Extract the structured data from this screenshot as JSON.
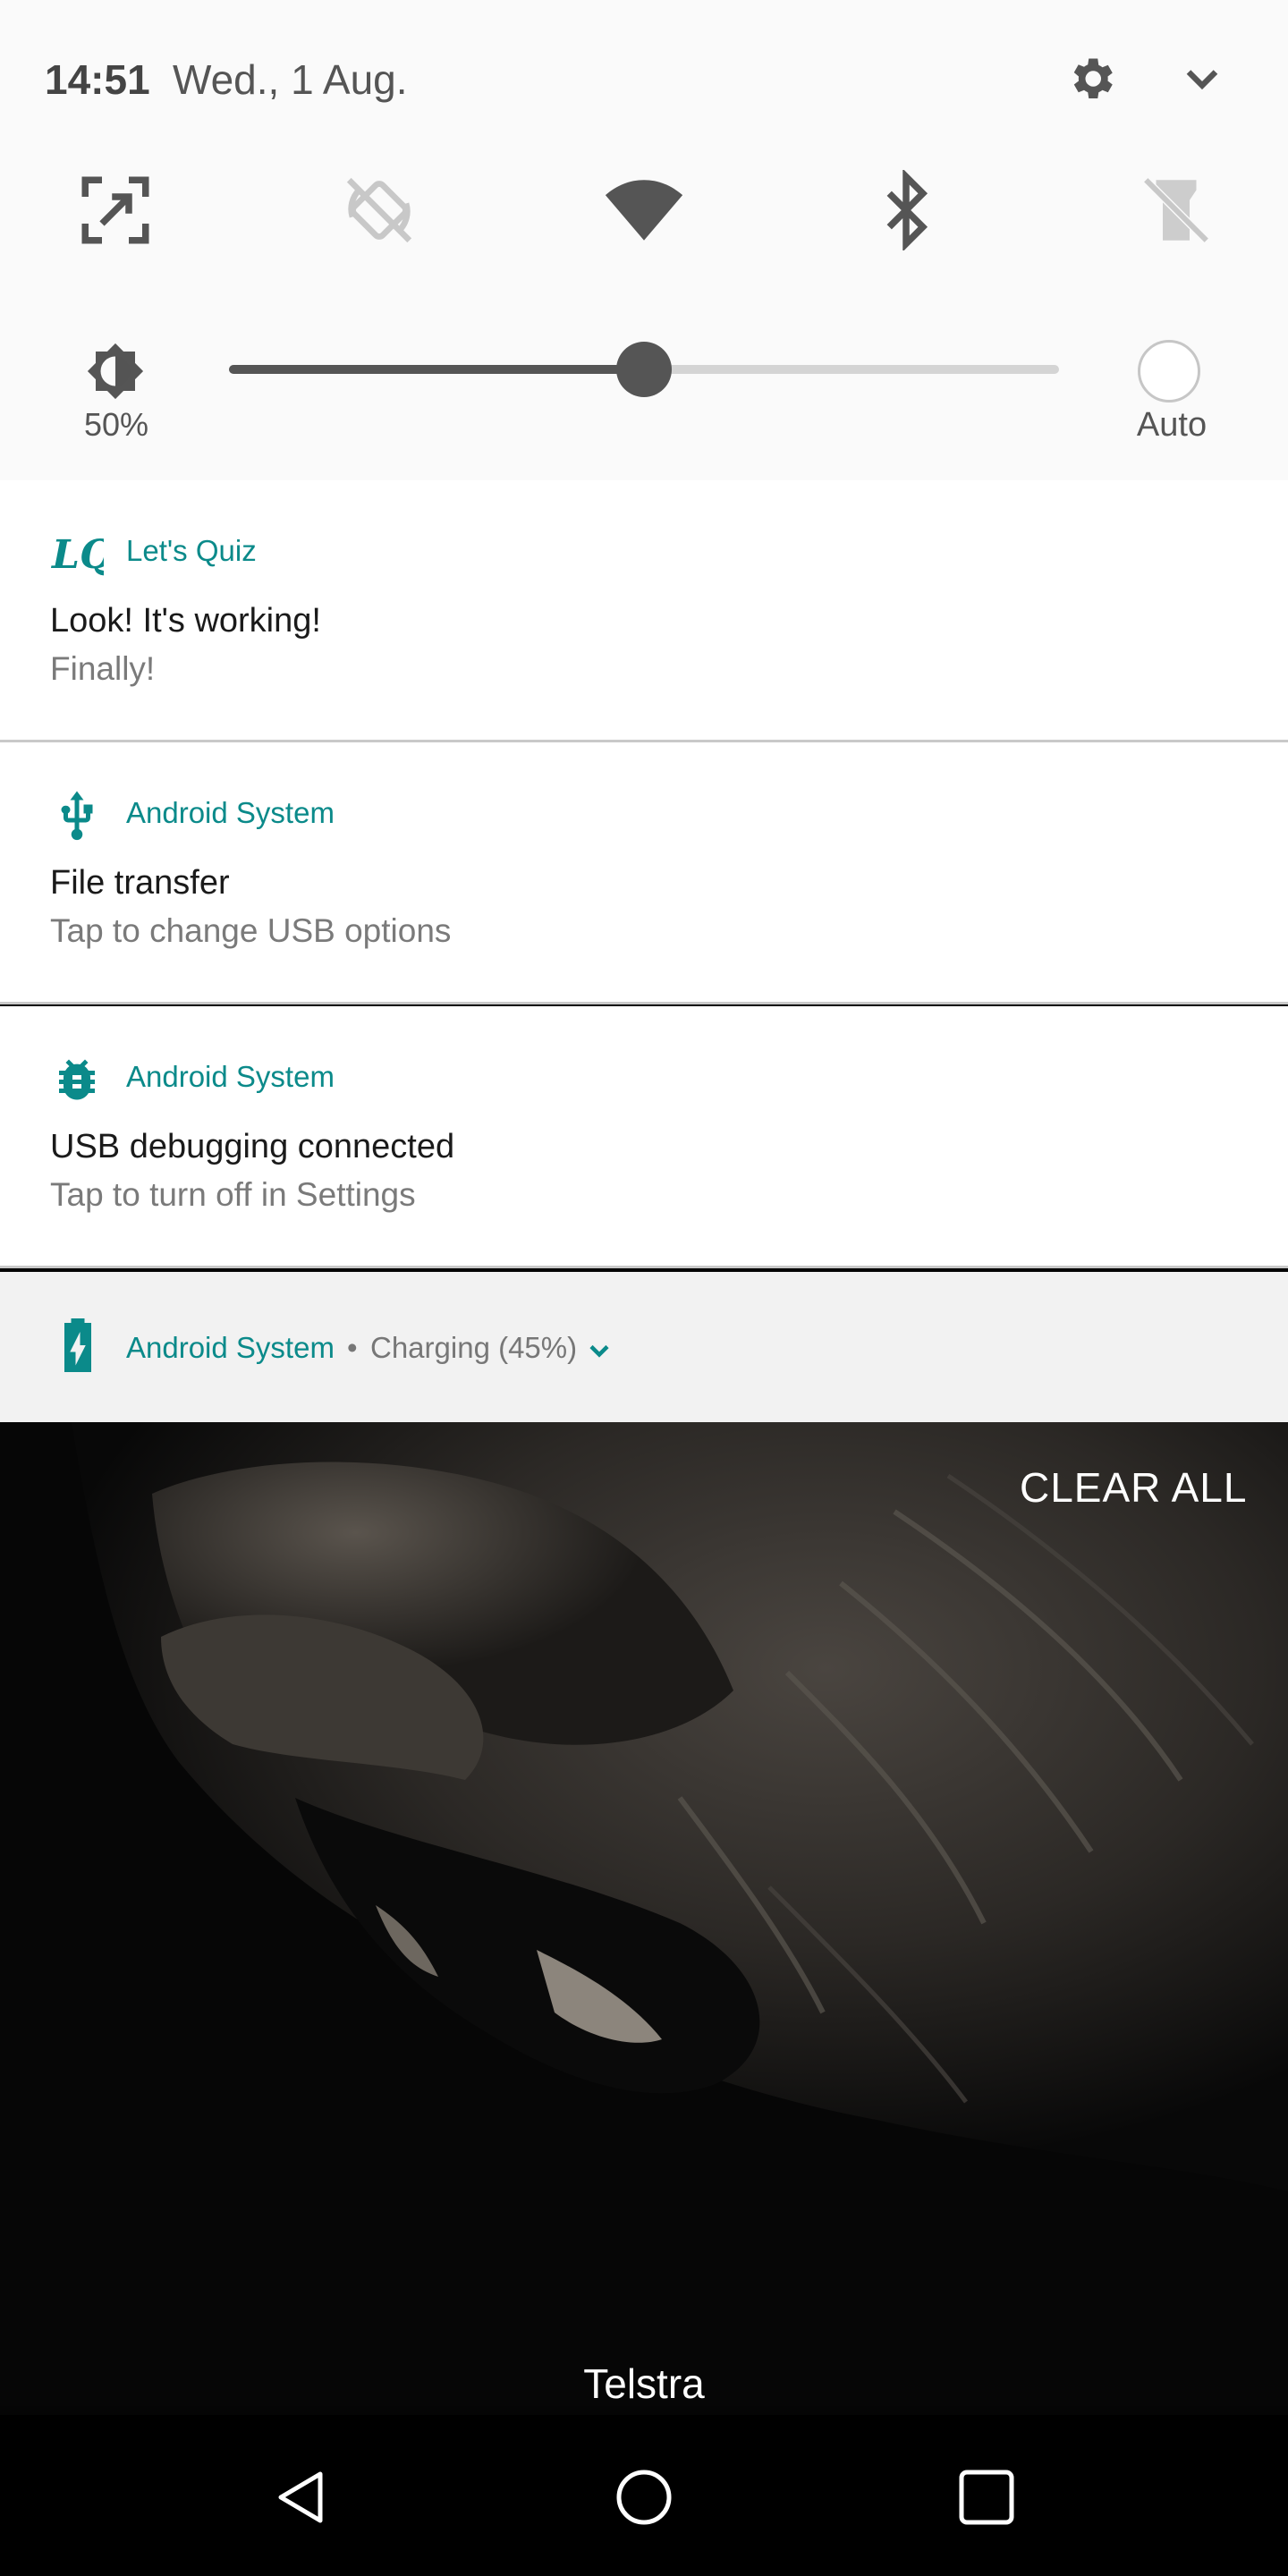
{
  "status_bar": {
    "time": "14:51",
    "date": "Wed., 1 Aug."
  },
  "quick_tiles": [
    {
      "name": "screenshot",
      "icon": "screenshot-icon",
      "active": true
    },
    {
      "name": "auto-rotate",
      "icon": "rotate-off-icon",
      "active": false
    },
    {
      "name": "wifi",
      "icon": "wifi-icon",
      "active": true
    },
    {
      "name": "bluetooth",
      "icon": "bluetooth-icon",
      "active": true
    },
    {
      "name": "flashlight",
      "icon": "flashlight-off-icon",
      "active": false
    }
  ],
  "brightness": {
    "percent_label": "50%",
    "level": 0.5,
    "auto_label": "Auto",
    "auto_enabled": false
  },
  "notifications": [
    {
      "app": "Let's Quiz",
      "icon": "lets-quiz-logo",
      "icon_text": "LQ",
      "title": "Look! It's working!",
      "text": "Finally!"
    },
    {
      "app": "Android System",
      "icon": "usb-icon",
      "title": "File transfer",
      "text": "Tap to change USB options"
    },
    {
      "app": "Android System",
      "icon": "android-bug-icon",
      "title": "USB debugging connected",
      "text": "Tap to turn off in Settings"
    }
  ],
  "collapsed_notification": {
    "app": "Android System",
    "separator": "•",
    "status": "Charging (45%)",
    "icon": "battery-charging-icon"
  },
  "clear_all_label": "CLEAR ALL",
  "carrier": "Telstra",
  "colors": {
    "accent": "#0b8a8a",
    "panel_bg": "#fafafa",
    "icon_gray": "#555555"
  },
  "nav": [
    "back-icon",
    "home-icon",
    "recents-icon"
  ]
}
